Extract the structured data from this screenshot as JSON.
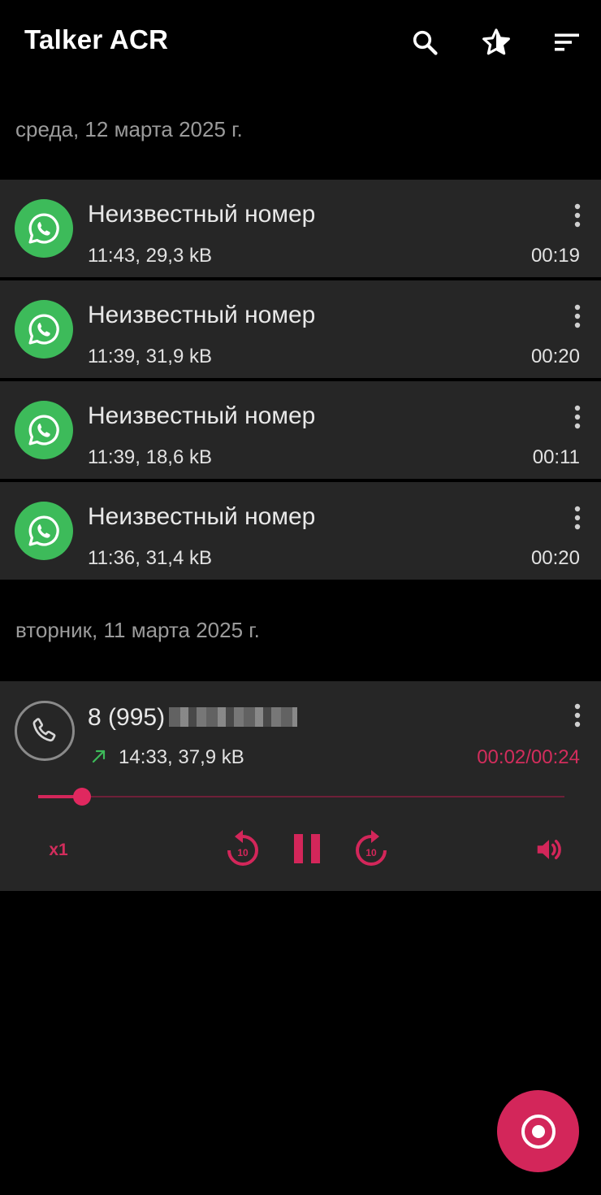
{
  "app": {
    "title": "Talker ACR"
  },
  "colors": {
    "accent": "#d3265a",
    "whatsapp": "#3dbb5a",
    "row_bg": "#262626",
    "outgoing_arrow": "#3dbb5a"
  },
  "toolbar": {
    "icons": [
      "search-icon",
      "star-icon",
      "sort-icon"
    ]
  },
  "groups": [
    {
      "date": "среда, 12 марта 2025 г.",
      "items": [
        {
          "name": "Неизвестный номер",
          "meta": "11:43, 29,3 kB",
          "duration": "00:19",
          "icon": "whatsapp-icon"
        },
        {
          "name": "Неизвестный номер",
          "meta": "11:39, 31,9 kB",
          "duration": "00:20",
          "icon": "whatsapp-icon"
        },
        {
          "name": "Неизвестный номер",
          "meta": "11:39, 18,6 kB",
          "duration": "00:11",
          "icon": "whatsapp-icon"
        },
        {
          "name": "Неизвестный номер",
          "meta": "11:36, 31,4 kB",
          "duration": "00:20",
          "icon": "whatsapp-icon"
        }
      ]
    },
    {
      "date": "вторник, 11 марта 2025 г."
    }
  ],
  "player": {
    "name": "8 (995)",
    "meta": "14:33, 37,9 kB",
    "time": "00:02/00:24",
    "progress": 0.0833,
    "speed": "x1",
    "rewind_label": "10",
    "forward_label": "10",
    "direction_icon": "outgoing-arrow-icon",
    "state": "playing"
  },
  "fab": {
    "icon": "record-icon"
  }
}
